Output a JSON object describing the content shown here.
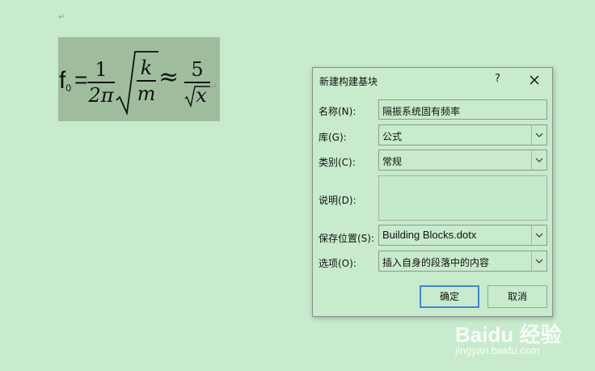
{
  "document": {
    "formula": {
      "lhs": "f",
      "lhs_subscript": "0",
      "equals": "=",
      "frac1_num": "1",
      "frac1_den": "2π",
      "sqrt_num": "k",
      "sqrt_den": "m",
      "approx": "≈",
      "frac2_num": "5",
      "frac2_den_radicand": "x"
    }
  },
  "dialog": {
    "title": "新建构建基块",
    "help": "?",
    "fields": {
      "name": {
        "label": "名称(N):",
        "value": "隔振系统固有频率"
      },
      "gallery": {
        "label": "库(G):",
        "value": "公式"
      },
      "category": {
        "label": "类别(C):",
        "value": "常规"
      },
      "description": {
        "label": "说明(D):",
        "value": ""
      },
      "save_in": {
        "label": "保存位置(S):",
        "value": "Building Blocks.dotx"
      },
      "options": {
        "label": "选项(O):",
        "value": "插入自身的段落中的内容"
      }
    },
    "ok_label": "确定",
    "cancel_label": "取消"
  },
  "watermark": {
    "logo": "Baidu 经验",
    "site": "jingyan.baidu.com"
  }
}
